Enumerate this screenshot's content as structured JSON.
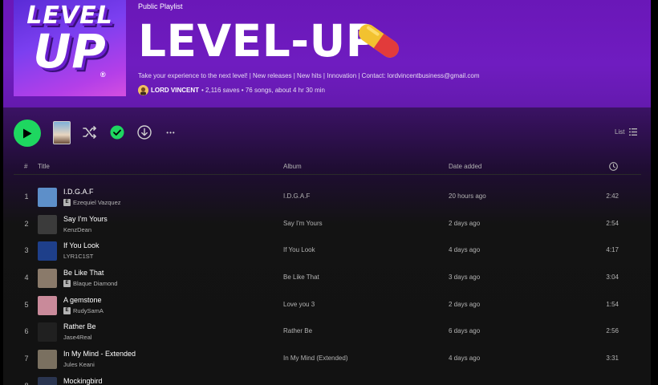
{
  "header": {
    "type_label": "Public Playlist",
    "title": "LEVEL-UP",
    "cover_top": "LEVEL",
    "cover_bottom": "UP",
    "cover_mark": "®",
    "description": "Take your experience to the next level! | New releases | New hits | Innovation | Contact: lordvincentbusiness@gmail.com",
    "owner": "LORD VINCENT",
    "stats": "• 2,116 saves • 76 songs, about 4 hr 30 min"
  },
  "controls": {
    "list_label": "List",
    "more": "•••"
  },
  "table": {
    "col_num": "#",
    "col_title": "Title",
    "col_album": "Album",
    "col_date": "Date added",
    "rows": [
      {
        "num": "1",
        "title": "I.D.G.A.F",
        "artist": "Ezequiel Vazquez",
        "explicit": true,
        "album": "I.D.G.A.F",
        "date": "20 hours ago",
        "duration": "2:42",
        "art_color": "#5d8fc9"
      },
      {
        "num": "2",
        "title": "Say I'm Yours",
        "artist": "KenzDean",
        "explicit": false,
        "album": "Say I'm Yours",
        "date": "2 days ago",
        "duration": "2:54",
        "art_color": "#3b3b3b"
      },
      {
        "num": "3",
        "title": "If You Look",
        "artist": "LYR1C1ST",
        "explicit": false,
        "album": "If You Look",
        "date": "4 days ago",
        "duration": "4:17",
        "art_color": "#1e3f8a"
      },
      {
        "num": "4",
        "title": "Be Like That",
        "artist": "Blaque Diamond",
        "explicit": true,
        "album": "Be Like That",
        "date": "3 days ago",
        "duration": "3:04",
        "art_color": "#8a7a6a"
      },
      {
        "num": "5",
        "title": "A gemstone",
        "artist": "RudySamA",
        "explicit": true,
        "album": "Love you 3",
        "date": "2 days ago",
        "duration": "1:54",
        "art_color": "#c98a9a"
      },
      {
        "num": "6",
        "title": "Rather Be",
        "artist": "Jase4Real",
        "explicit": false,
        "album": "Rather Be",
        "date": "6 days ago",
        "duration": "2:56",
        "art_color": "#202020"
      },
      {
        "num": "7",
        "title": "In My Mind - Extended",
        "artist": "Jules Keani",
        "explicit": false,
        "album": "In My Mind (Extended)",
        "date": "4 days ago",
        "duration": "3:31",
        "art_color": "#7a7060"
      },
      {
        "num": "8",
        "title": "Mockingbird",
        "artist": "",
        "explicit": false,
        "album": "",
        "date": "",
        "duration": "",
        "art_color": "#2a3550"
      }
    ]
  },
  "colors": {
    "accent": "#1ed760",
    "header_purple": "#6f1cc0"
  }
}
